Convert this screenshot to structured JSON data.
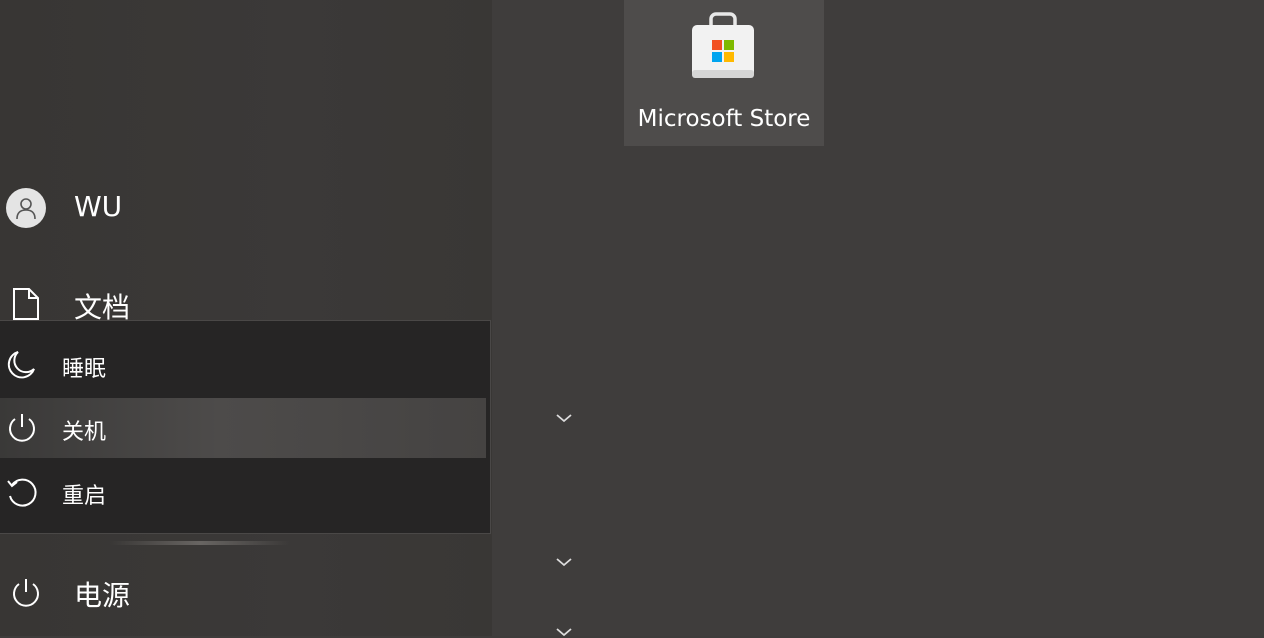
{
  "user": {
    "name": "WU"
  },
  "sidebar": {
    "documents_label": "文档",
    "power_label": "电源"
  },
  "power_menu": {
    "items": [
      {
        "label": "睡眠",
        "icon": "moon-icon"
      },
      {
        "label": "关机",
        "icon": "power-icon",
        "selected": true
      },
      {
        "label": "重启",
        "icon": "restart-icon"
      }
    ]
  },
  "tiles": {
    "store": {
      "label": "Microsoft Store",
      "icon": "microsoft-store-bag-icon"
    }
  },
  "colors": {
    "background": "#3e3c3b",
    "menu_background": "#262525",
    "tile_background": "#4e4c4b",
    "logo_red": "#f25022",
    "logo_green": "#7fba00",
    "logo_blue": "#00a4ef",
    "logo_yellow": "#ffb900"
  }
}
